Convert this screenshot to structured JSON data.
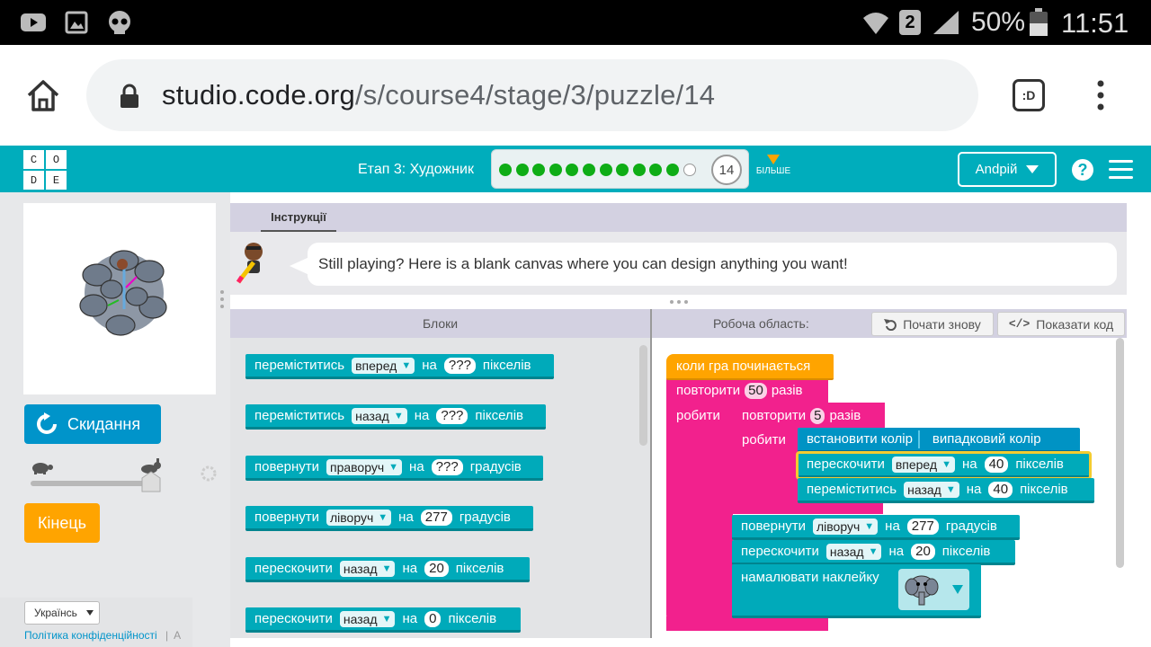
{
  "status_bar": {
    "left_icons": [
      "youtube-icon",
      "image-icon",
      "skull-icon"
    ],
    "battery": "50%",
    "time": "11:51",
    "sim_badge": "2"
  },
  "browser": {
    "url_host": "studio.code.org",
    "url_path": "/s/course4/stage/3/puzzle/14",
    "tab_icon_label": ":D"
  },
  "header": {
    "logo_letters": [
      "C",
      "O",
      "D",
      "E"
    ],
    "stage_title": "Етап 3: Художник",
    "progress": {
      "completed": 11,
      "total": 13,
      "current": "14"
    },
    "more_label": "БІЛЬШЕ",
    "user_name": "Andрій",
    "help": "?"
  },
  "left": {
    "reset_label": "Скидання",
    "finish_label": "Кінець",
    "language": "Українсь",
    "privacy_link": "Політика конфіденційності",
    "footer_sep": "|",
    "footer_more": "A"
  },
  "instructions": {
    "tab_label": "Інструкції",
    "text": "Still playing? Here is a blank canvas where you can design anything you want!"
  },
  "workspace": {
    "toolbox_header": "Блоки",
    "workspace_header": "Робоча область:",
    "restart_label": "Почати знову",
    "show_code_label": "Показати код"
  },
  "toolbox_blocks": [
    {
      "pre": "переміститись",
      "dd": "вперед",
      "mid": "на",
      "num": "???",
      "post": "пікселів"
    },
    {
      "pre": "переміститись",
      "dd": "назад",
      "mid": "на",
      "num": "???",
      "post": "пікселів"
    },
    {
      "pre": "повернути",
      "dd": "праворуч",
      "mid": "на",
      "num": "???",
      "post": "градусів"
    },
    {
      "pre": "повернути",
      "dd": "ліворуч",
      "mid": "на",
      "num": "277",
      "post": "градусів"
    },
    {
      "pre": "перескочити",
      "dd": "назад",
      "mid": "на",
      "num": "20",
      "post": "пікселів"
    },
    {
      "pre": "перескочити",
      "dd": "назад",
      "mid": "на",
      "num": "0",
      "post": "пікселів"
    }
  ],
  "program": {
    "when_run": "коли гра починається",
    "repeat1": {
      "pre": "повторити",
      "num": "50",
      "post": "разів",
      "do": "робити"
    },
    "repeat2": {
      "pre": "повторити",
      "num": "5",
      "post": "разів",
      "do": "робити"
    },
    "set_color": {
      "pre": "встановити колір",
      "value": "випадковий колір"
    },
    "inner": [
      {
        "pre": "перескочити",
        "dd": "вперед",
        "mid": "на",
        "num": "40",
        "post": "пікселів"
      },
      {
        "pre": "переміститись",
        "dd": "назад",
        "mid": "на",
        "num": "40",
        "post": "пікселів"
      }
    ],
    "outer": [
      {
        "pre": "повернути",
        "dd": "ліворуч",
        "mid": "на",
        "num": "277",
        "post": "градусів"
      },
      {
        "pre": "перескочити",
        "dd": "назад",
        "mid": "на",
        "num": "20",
        "post": "пікселів"
      }
    ],
    "sticker": {
      "pre": "намалювати наклейку",
      "value": "elephant"
    }
  },
  "colors": {
    "teal": "#00adbc",
    "pink": "#f2218d",
    "orange": "#ffa400",
    "reset_blue": "#0094ca",
    "progress_green": "#0fad16"
  }
}
